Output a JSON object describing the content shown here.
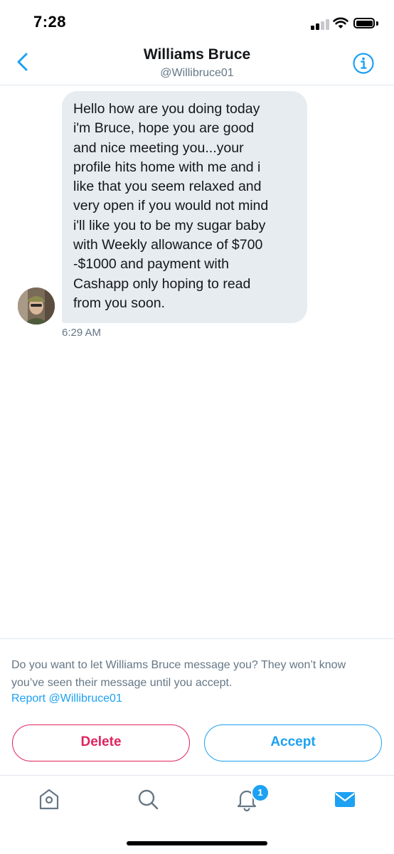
{
  "status_bar": {
    "time": "7:28"
  },
  "header": {
    "name": "Williams Bruce",
    "handle": "@Willibruce01",
    "back_icon": "chevron-left-icon",
    "info_icon": "info-icon"
  },
  "conversation": {
    "messages": [
      {
        "text": "Hello how are you doing today\ni'm Bruce, hope you are good\nand nice meeting you...your\nprofile hits home with me and i\nlike that you seem relaxed and\nvery open if you would not mind\ni'll like you to be my sugar baby\nwith Weekly allowance of $700\n-$1000  and payment with\nCashapp only hoping to read\nfrom you soon.",
        "time": "6:29 AM"
      }
    ]
  },
  "request": {
    "prompt": "Do you want to let Williams Bruce message you? They won’t know you’ve seen their message until you accept.",
    "report_label": "Report @Willibruce01",
    "delete_label": "Delete",
    "accept_label": "Accept"
  },
  "tabbar": {
    "notifications_badge": "1",
    "items": [
      "home-icon",
      "search-icon",
      "notifications-icon",
      "messages-icon"
    ]
  },
  "colors": {
    "accent": "#1da1f2",
    "danger": "#e0245e",
    "bubble": "#e6ecf0",
    "secondary_text": "#657786"
  }
}
